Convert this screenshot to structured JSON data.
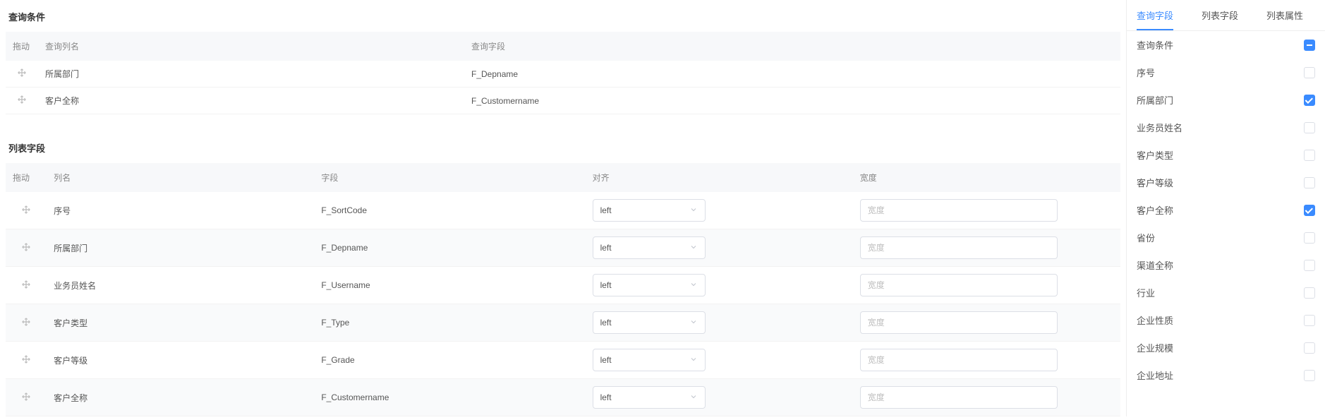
{
  "sections": {
    "query_title": "查询条件",
    "list_title": "列表字段"
  },
  "query_table": {
    "headers": {
      "drag": "拖动",
      "name": "查询列名",
      "field": "查询字段"
    },
    "rows": [
      {
        "name": "所属部门",
        "field": "F_Depname"
      },
      {
        "name": "客户全称",
        "field": "F_Customername"
      }
    ]
  },
  "list_table": {
    "headers": {
      "drag": "拖动",
      "name": "列名",
      "field": "字段",
      "align": "对齐",
      "width": "宽度"
    },
    "width_placeholder": "宽度",
    "rows": [
      {
        "name": "序号",
        "field": "F_SortCode",
        "align": "left",
        "width": ""
      },
      {
        "name": "所属部门",
        "field": "F_Depname",
        "align": "left",
        "width": ""
      },
      {
        "name": "业务员姓名",
        "field": "F_Username",
        "align": "left",
        "width": ""
      },
      {
        "name": "客户类型",
        "field": "F_Type",
        "align": "left",
        "width": ""
      },
      {
        "name": "客户等级",
        "field": "F_Grade",
        "align": "left",
        "width": ""
      },
      {
        "name": "客户全称",
        "field": "F_Customername",
        "align": "left",
        "width": ""
      }
    ]
  },
  "side": {
    "tabs": [
      {
        "label": "查询字段",
        "active": true
      },
      {
        "label": "列表字段",
        "active": false
      },
      {
        "label": "列表属性",
        "active": false
      }
    ],
    "items": [
      {
        "label": "查询条件",
        "control": "minus"
      },
      {
        "label": "序号",
        "control": "checkbox",
        "checked": false
      },
      {
        "label": "所属部门",
        "control": "checkbox",
        "checked": true
      },
      {
        "label": "业务员姓名",
        "control": "checkbox",
        "checked": false
      },
      {
        "label": "客户类型",
        "control": "checkbox",
        "checked": false
      },
      {
        "label": "客户等级",
        "control": "checkbox",
        "checked": false
      },
      {
        "label": "客户全称",
        "control": "checkbox",
        "checked": true
      },
      {
        "label": "省份",
        "control": "checkbox",
        "checked": false
      },
      {
        "label": "渠道全称",
        "control": "checkbox",
        "checked": false
      },
      {
        "label": "行业",
        "control": "checkbox",
        "checked": false
      },
      {
        "label": "企业性质",
        "control": "checkbox",
        "checked": false
      },
      {
        "label": "企业规模",
        "control": "checkbox",
        "checked": false
      },
      {
        "label": "企业地址",
        "control": "checkbox",
        "checked": false
      }
    ]
  }
}
